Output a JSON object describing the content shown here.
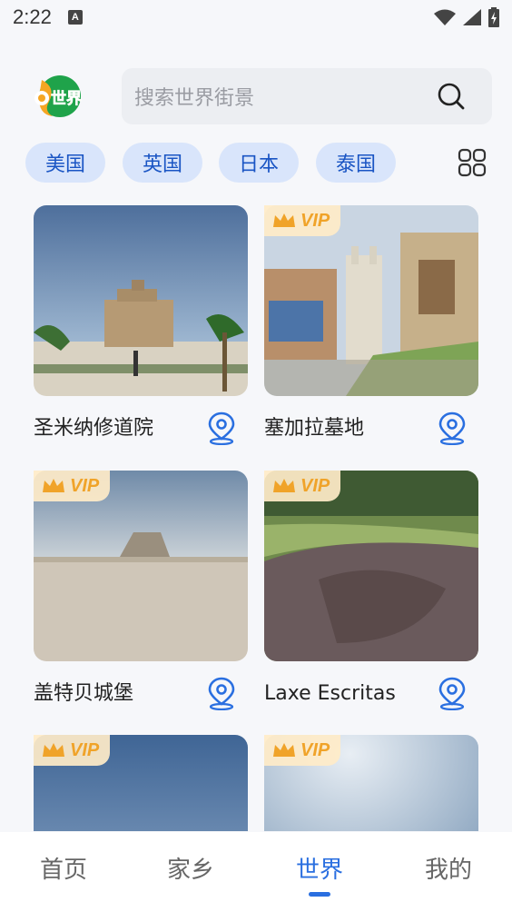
{
  "status": {
    "time": "2:22",
    "notif": "A",
    "icons": [
      "wifi-icon",
      "signal-icon",
      "battery-icon"
    ]
  },
  "header": {
    "logo_text": "世界",
    "search_placeholder": "搜索世界街景"
  },
  "chips": [
    "美国",
    "英国",
    "日本",
    "泰国"
  ],
  "cards": [
    {
      "title": "圣米纳修道院",
      "vip": false,
      "vip_text": ""
    },
    {
      "title": "塞加拉墓地",
      "vip": true,
      "vip_text": "VIP"
    },
    {
      "title": "盖特贝城堡",
      "vip": true,
      "vip_text": "VIP"
    },
    {
      "title": "Laxe Escritas",
      "vip": true,
      "vip_text": "VIP"
    },
    {
      "title": "",
      "vip": true,
      "vip_text": "VIP"
    },
    {
      "title": "",
      "vip": true,
      "vip_text": "VIP"
    }
  ],
  "nav": [
    {
      "label": "首页",
      "active": false
    },
    {
      "label": "家乡",
      "active": false
    },
    {
      "label": "世界",
      "active": true
    },
    {
      "label": "我的",
      "active": false
    }
  ],
  "colors": {
    "accent": "#2a6fe0",
    "chip_bg": "#d9e5fb",
    "vip": "#f0a329",
    "logo_green": "#1fa34a",
    "logo_orange": "#f5a623"
  }
}
